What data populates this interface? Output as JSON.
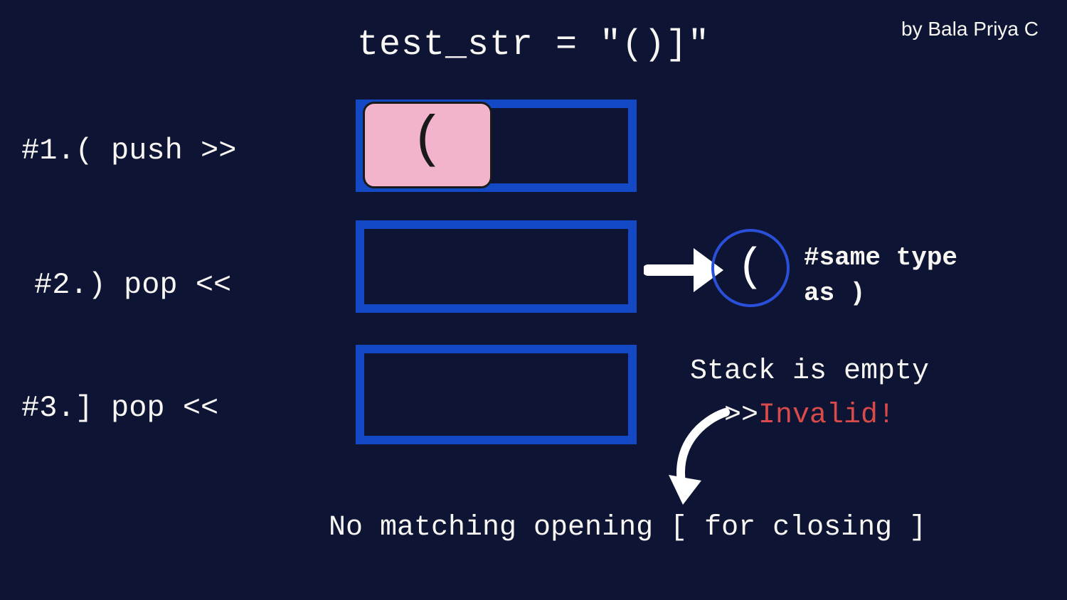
{
  "title": "test_str = \"()]\"",
  "byline": "by Bala Priya C",
  "steps": {
    "s1": "#1.( push >>",
    "s2": "#2.) pop <<",
    "s3": "#3.] pop <<"
  },
  "pink_char": "(",
  "popped_char": "(",
  "note_same_line1": "#same type",
  "note_same_line2": "as )",
  "note_empty": "Stack is empty",
  "note_invalid_prefix": ">>",
  "note_invalid_word": "Invalid!",
  "bottom_msg": "No matching opening [ for closing ]"
}
